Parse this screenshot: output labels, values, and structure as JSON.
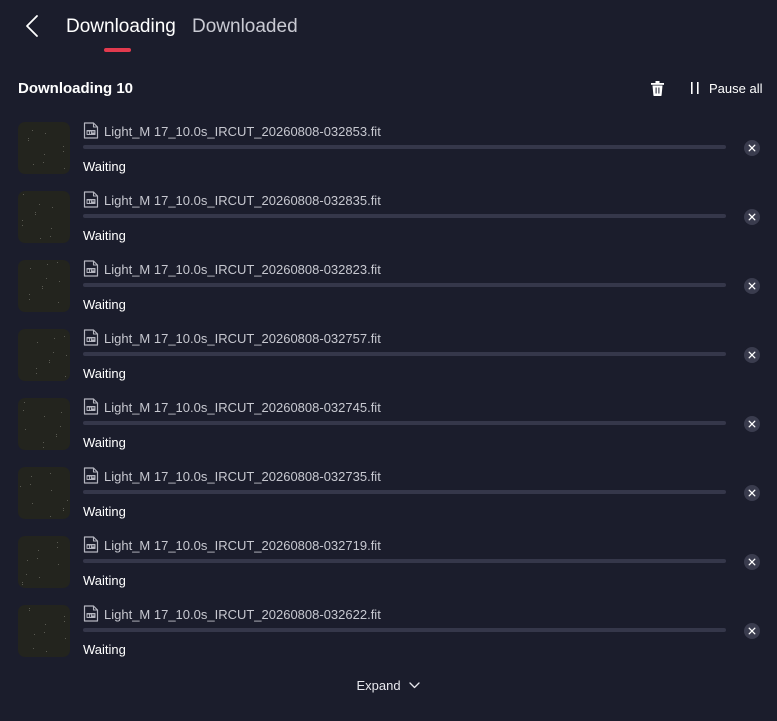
{
  "header": {
    "tabs": [
      {
        "label": "Downloading",
        "active": true
      },
      {
        "label": "Downloaded",
        "active": false
      }
    ],
    "accent_color": "#e23a4e"
  },
  "section": {
    "title": "Downloading 10",
    "pause_all_label": "Pause all"
  },
  "downloads": [
    {
      "file_name": "Light_M 17_10.0s_IRCUT_20260808-032853.fit",
      "status": "Waiting",
      "progress": 0
    },
    {
      "file_name": "Light_M 17_10.0s_IRCUT_20260808-032835.fit",
      "status": "Waiting",
      "progress": 0
    },
    {
      "file_name": "Light_M 17_10.0s_IRCUT_20260808-032823.fit",
      "status": "Waiting",
      "progress": 0
    },
    {
      "file_name": "Light_M 17_10.0s_IRCUT_20260808-032757.fit",
      "status": "Waiting",
      "progress": 0
    },
    {
      "file_name": "Light_M 17_10.0s_IRCUT_20260808-032745.fit",
      "status": "Waiting",
      "progress": 0
    },
    {
      "file_name": "Light_M 17_10.0s_IRCUT_20260808-032735.fit",
      "status": "Waiting",
      "progress": 0
    },
    {
      "file_name": "Light_M 17_10.0s_IRCUT_20260808-032719.fit",
      "status": "Waiting",
      "progress": 0
    },
    {
      "file_name": "Light_M 17_10.0s_IRCUT_20260808-032622.fit",
      "status": "Waiting",
      "progress": 0
    }
  ],
  "footer": {
    "expand_label": "Expand"
  },
  "icons": {
    "back": "chevron-left-icon",
    "delete": "trash-icon",
    "pause": "pause-icon",
    "file": "fit-file-icon",
    "remove": "close-icon",
    "expand": "chevron-down-icon"
  }
}
